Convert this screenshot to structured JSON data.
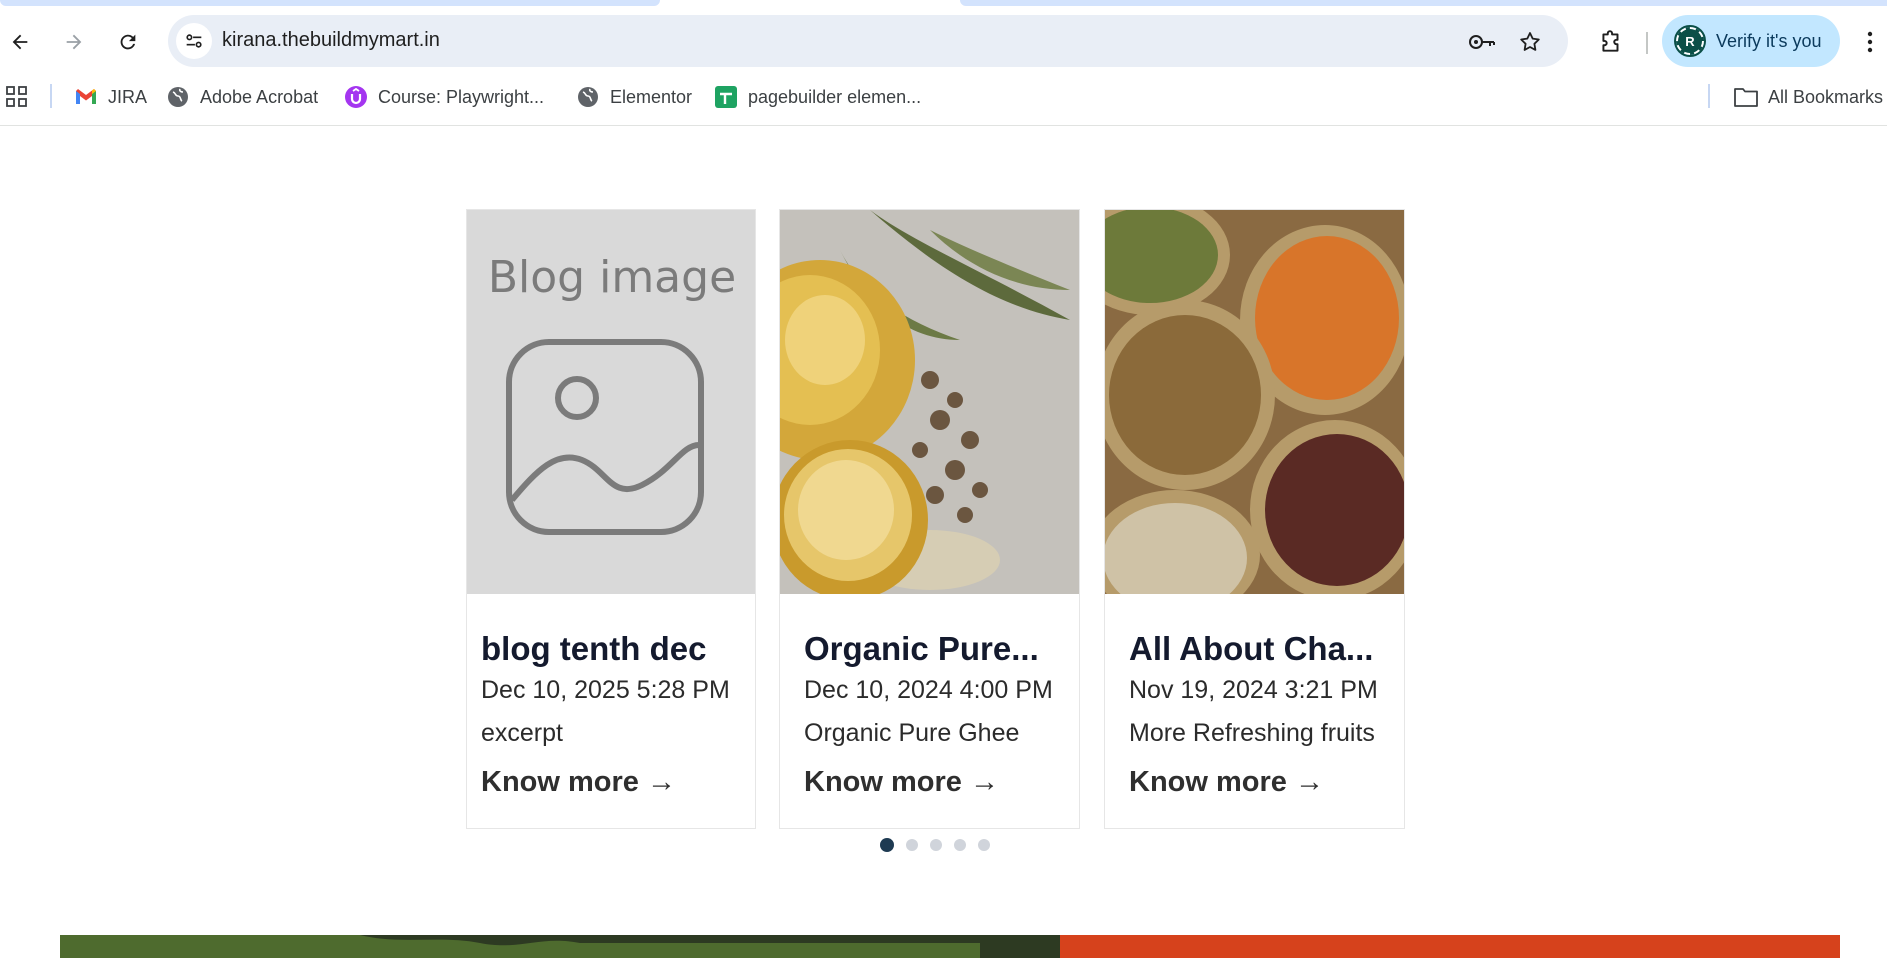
{
  "browser": {
    "url": "kirana.thebuildmymart.in",
    "profile_initial": "R",
    "profile_label": "Verify it's you"
  },
  "bookmarks": {
    "items": [
      {
        "label": "JIRA",
        "icon": "gmail-icon"
      },
      {
        "label": "Adobe Acrobat",
        "icon": "globe-icon"
      },
      {
        "label": "Course: Playwright...",
        "icon": "udemy-icon"
      },
      {
        "label": "Elementor",
        "icon": "globe-icon"
      },
      {
        "label": "pagebuilder elemen...",
        "icon": "sheets-icon"
      }
    ],
    "all_bookmarks": "All Bookmarks"
  },
  "blog": {
    "cards": [
      {
        "title": "blog tenth dec",
        "date": "Dec 10, 2025 5:28 PM",
        "excerpt": "excerpt",
        "link": "Know more →",
        "image": "placeholder",
        "placeholder_text": "Blog image"
      },
      {
        "title": "Organic Pure...",
        "date": "Dec 10, 2024 4:00 PM",
        "excerpt": "Organic Pure Ghee",
        "link": "Know more →",
        "image": "ghee-photo"
      },
      {
        "title": "All About Cha...",
        "date": "Nov 19, 2024 3:21 PM",
        "excerpt": "More Refreshing fruits",
        "link": "Know more →",
        "image": "grains-photo"
      }
    ],
    "pagination": {
      "total": 5,
      "active": 1
    }
  },
  "colors": {
    "accent": "#1e3a52",
    "omnibox": "#e9eef6",
    "profile_chip": "#c2e7ff"
  }
}
